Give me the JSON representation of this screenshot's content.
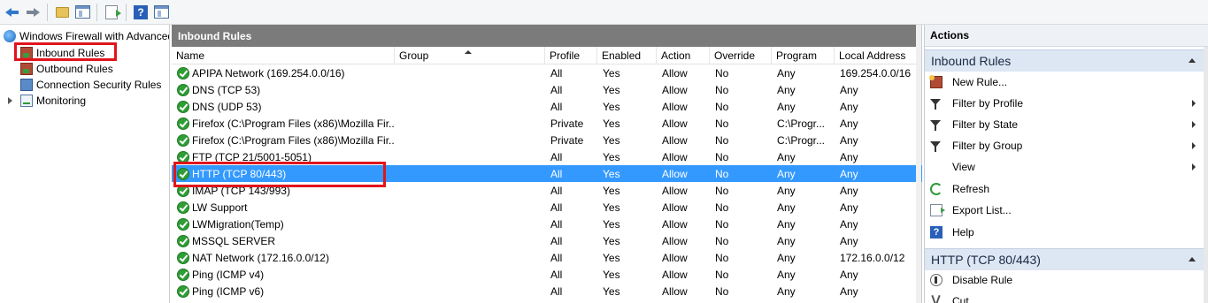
{
  "toolbar": {
    "buttons": [
      "back-icon",
      "forward-icon",
      "up-folder-icon",
      "show-hide-console-tree-icon",
      "export-list-icon",
      "help-icon",
      "show-hide-action-pane-icon"
    ]
  },
  "tree": {
    "root_label": "Windows Firewall with Advanced Security",
    "items": [
      {
        "label": "Inbound Rules"
      },
      {
        "label": "Outbound Rules"
      },
      {
        "label": "Connection Security Rules"
      },
      {
        "label": "Monitoring"
      }
    ]
  },
  "center": {
    "title": "Inbound Rules",
    "columns": [
      "Name",
      "Group",
      "Profile",
      "Enabled",
      "Action",
      "Override",
      "Program",
      "Local Address"
    ],
    "rows": [
      {
        "name": "APIPA Network (169.254.0.0/16)",
        "group": "",
        "profile": "All",
        "enabled": "Yes",
        "action": "Allow",
        "override": "No",
        "program": "Any",
        "local": "169.254.0.0/16"
      },
      {
        "name": "DNS (TCP 53)",
        "group": "",
        "profile": "All",
        "enabled": "Yes",
        "action": "Allow",
        "override": "No",
        "program": "Any",
        "local": "Any"
      },
      {
        "name": "DNS (UDP 53)",
        "group": "",
        "profile": "All",
        "enabled": "Yes",
        "action": "Allow",
        "override": "No",
        "program": "Any",
        "local": "Any"
      },
      {
        "name": "Firefox (C:\\Program Files (x86)\\Mozilla Fir...",
        "group": "",
        "profile": "Private",
        "enabled": "Yes",
        "action": "Allow",
        "override": "No",
        "program": "C:\\Progr...",
        "local": "Any"
      },
      {
        "name": "Firefox (C:\\Program Files (x86)\\Mozilla Fir...",
        "group": "",
        "profile": "Private",
        "enabled": "Yes",
        "action": "Allow",
        "override": "No",
        "program": "C:\\Progr...",
        "local": "Any"
      },
      {
        "name": "FTP (TCP 21/5001-5051)",
        "group": "",
        "profile": "All",
        "enabled": "Yes",
        "action": "Allow",
        "override": "No",
        "program": "Any",
        "local": "Any"
      },
      {
        "name": "HTTP (TCP 80/443)",
        "group": "",
        "profile": "All",
        "enabled": "Yes",
        "action": "Allow",
        "override": "No",
        "program": "Any",
        "local": "Any"
      },
      {
        "name": "IMAP (TCP 143/993)",
        "group": "",
        "profile": "All",
        "enabled": "Yes",
        "action": "Allow",
        "override": "No",
        "program": "Any",
        "local": "Any"
      },
      {
        "name": "LW Support",
        "group": "",
        "profile": "All",
        "enabled": "Yes",
        "action": "Allow",
        "override": "No",
        "program": "Any",
        "local": "Any"
      },
      {
        "name": "LWMigration(Temp)",
        "group": "",
        "profile": "All",
        "enabled": "Yes",
        "action": "Allow",
        "override": "No",
        "program": "Any",
        "local": "Any"
      },
      {
        "name": "MSSQL SERVER",
        "group": "",
        "profile": "All",
        "enabled": "Yes",
        "action": "Allow",
        "override": "No",
        "program": "Any",
        "local": "Any"
      },
      {
        "name": "NAT Network (172.16.0.0/12)",
        "group": "",
        "profile": "All",
        "enabled": "Yes",
        "action": "Allow",
        "override": "No",
        "program": "Any",
        "local": "172.16.0.0/12"
      },
      {
        "name": "Ping (ICMP v4)",
        "group": "",
        "profile": "All",
        "enabled": "Yes",
        "action": "Allow",
        "override": "No",
        "program": "Any",
        "local": "Any"
      },
      {
        "name": "Ping (ICMP v6)",
        "group": "",
        "profile": "All",
        "enabled": "Yes",
        "action": "Allow",
        "override": "No",
        "program": "Any",
        "local": "Any"
      }
    ],
    "selected_row": "HTTP (TCP 80/443)"
  },
  "actions": {
    "title": "Actions",
    "group1": {
      "label": "Inbound Rules",
      "items": [
        {
          "label": "New Rule...",
          "icon": "new-rule-icon"
        },
        {
          "label": "Filter by Profile",
          "icon": "filter-icon"
        },
        {
          "label": "Filter by State",
          "icon": "filter-icon"
        },
        {
          "label": "Filter by Group",
          "icon": "filter-icon"
        },
        {
          "label": "View",
          "icon": ""
        },
        {
          "label": "Refresh",
          "icon": "refresh-icon"
        },
        {
          "label": "Export List...",
          "icon": "export-icon"
        },
        {
          "label": "Help",
          "icon": "help-icon"
        }
      ]
    },
    "group2": {
      "label": "HTTP (TCP 80/443)",
      "items": [
        {
          "label": "Disable Rule",
          "icon": "disable-icon"
        },
        {
          "label": "Cut",
          "icon": "cut-icon"
        }
      ]
    }
  },
  "colors": {
    "selection": "#3399ff",
    "highlight_box": "#e1141b",
    "pane_title": "#7b7b7b",
    "enabled_check": "#2f9e35"
  }
}
